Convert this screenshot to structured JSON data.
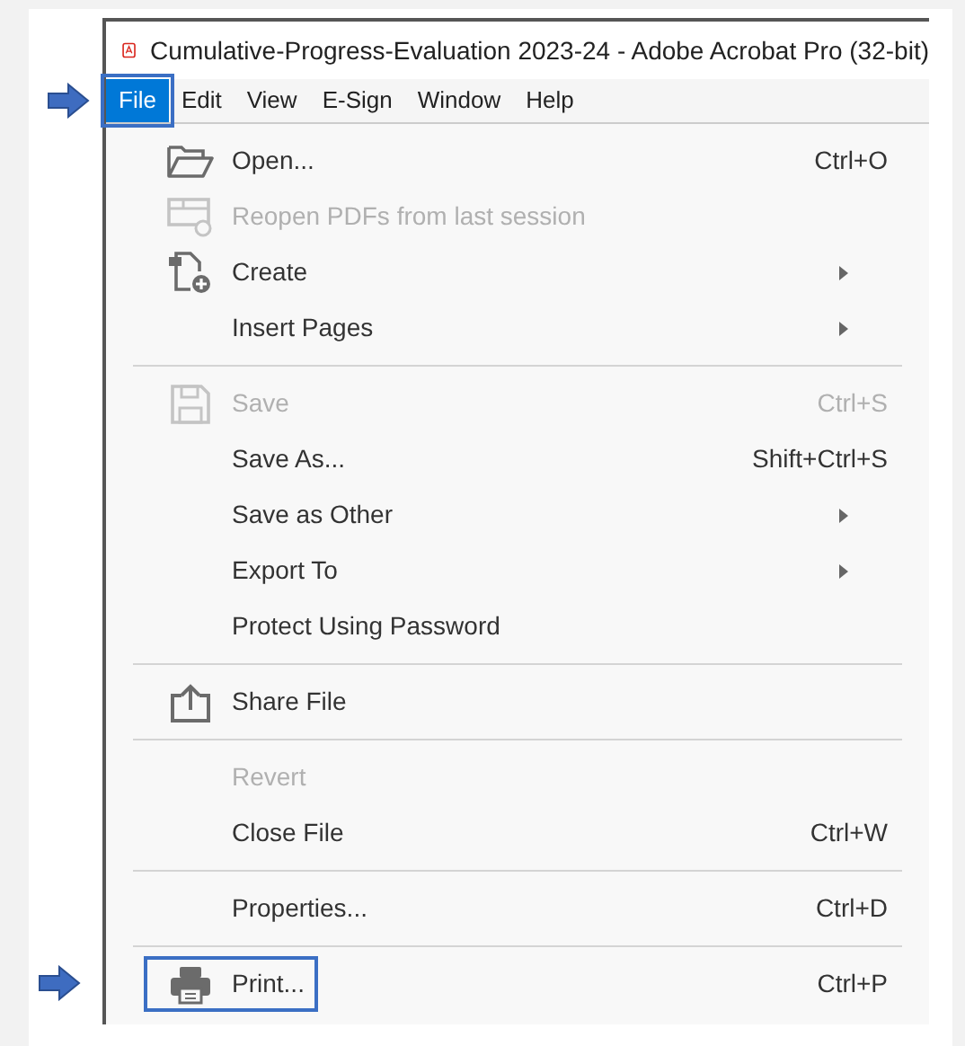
{
  "window": {
    "title": "Cumulative-Progress-Evaluation 2023-24 - Adobe Acrobat Pro (32-bit)"
  },
  "menu_bar": [
    {
      "label": "File",
      "selected": true
    },
    {
      "label": "Edit",
      "selected": false
    },
    {
      "label": "View",
      "selected": false
    },
    {
      "label": "E-Sign",
      "selected": false
    },
    {
      "label": "Window",
      "selected": false
    },
    {
      "label": "Help",
      "selected": false
    }
  ],
  "file_menu": {
    "groups": [
      [
        {
          "label": "Open...",
          "shortcut": "Ctrl+O",
          "disabled": false,
          "submenu": false,
          "highlighted": false
        },
        {
          "label": "Reopen PDFs from last session",
          "disabled": true,
          "submenu": false,
          "highlighted": false
        },
        {
          "label": "Create",
          "disabled": false,
          "submenu": true,
          "highlighted": false
        },
        {
          "label": "Insert Pages",
          "disabled": false,
          "submenu": true,
          "highlighted": false
        }
      ],
      [
        {
          "label": "Save",
          "shortcut": "Ctrl+S",
          "disabled": true,
          "submenu": false,
          "highlighted": false
        },
        {
          "label": "Save As...",
          "shortcut": "Shift+Ctrl+S",
          "disabled": false,
          "submenu": false,
          "highlighted": false
        },
        {
          "label": "Save as Other",
          "disabled": false,
          "submenu": true,
          "highlighted": false
        },
        {
          "label": "Export To",
          "disabled": false,
          "submenu": true,
          "highlighted": false
        },
        {
          "label": "Protect Using Password",
          "disabled": false,
          "submenu": false,
          "highlighted": false
        }
      ],
      [
        {
          "label": "Share File",
          "disabled": false,
          "submenu": false,
          "highlighted": false
        }
      ],
      [
        {
          "label": "Revert",
          "disabled": true,
          "submenu": false,
          "highlighted": false
        },
        {
          "label": "Close File",
          "shortcut": "Ctrl+W",
          "disabled": false,
          "submenu": false,
          "highlighted": false
        }
      ],
      [
        {
          "label": "Properties...",
          "shortcut": "Ctrl+D",
          "disabled": false,
          "submenu": false,
          "highlighted": false
        }
      ],
      [
        {
          "label": "Print...",
          "shortcut": "Ctrl+P",
          "disabled": false,
          "submenu": false,
          "highlighted": true
        }
      ]
    ]
  }
}
